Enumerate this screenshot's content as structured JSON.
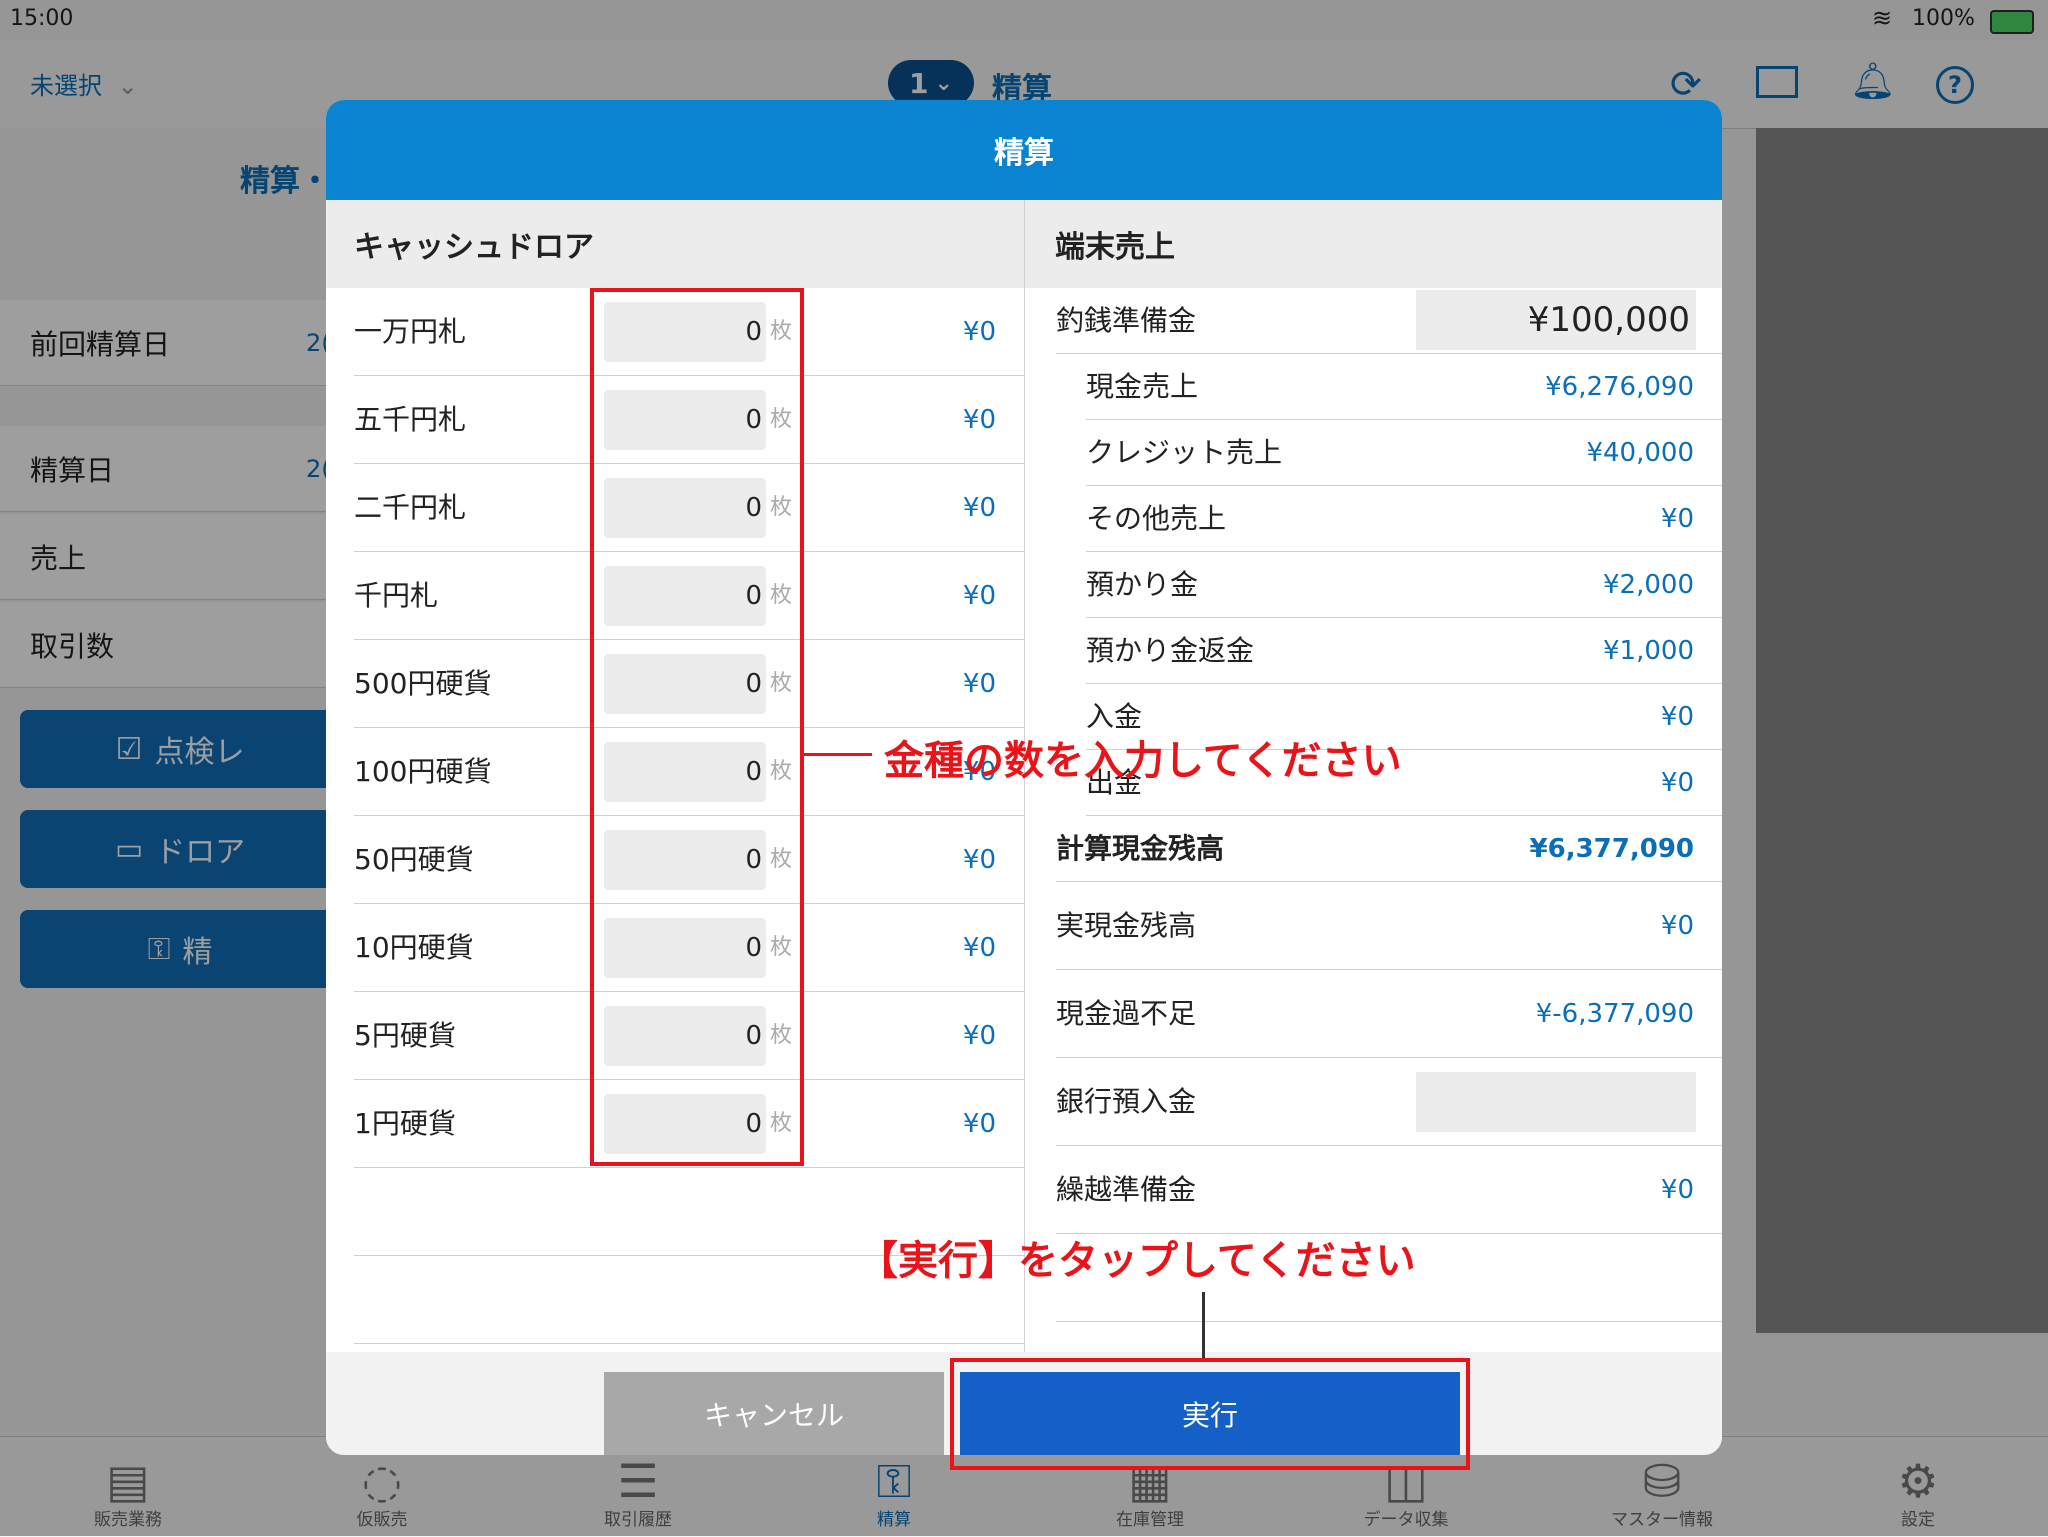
{
  "status_bar": {
    "time": "15:00",
    "battery": "100%"
  },
  "header": {
    "store_selector": "未選択",
    "register_number": "1",
    "title": "精算"
  },
  "background": {
    "section_title": "精算・",
    "rows": [
      {
        "label": "前回精算日",
        "value": "2("
      },
      {
        "label": "精算日",
        "value": "2("
      },
      {
        "label": "売上",
        "value": ""
      },
      {
        "label": "取引数",
        "value": ""
      }
    ],
    "buttons": [
      "点検レ",
      "ドロア",
      "精"
    ]
  },
  "modal": {
    "title": "精算",
    "left": {
      "header": "キャッシュドロア",
      "unit": "枚",
      "rows": [
        {
          "label": "一万円札",
          "count": "0",
          "amount": "¥0"
        },
        {
          "label": "五千円札",
          "count": "0",
          "amount": "¥0"
        },
        {
          "label": "二千円札",
          "count": "0",
          "amount": "¥0"
        },
        {
          "label": "千円札",
          "count": "0",
          "amount": "¥0"
        },
        {
          "label": "500円硬貨",
          "count": "0",
          "amount": "¥0"
        },
        {
          "label": "100円硬貨",
          "count": "0",
          "amount": "¥0"
        },
        {
          "label": "50円硬貨",
          "count": "0",
          "amount": "¥0"
        },
        {
          "label": "10円硬貨",
          "count": "0",
          "amount": "¥0"
        },
        {
          "label": "5円硬貨",
          "count": "0",
          "amount": "¥0"
        },
        {
          "label": "1円硬貨",
          "count": "0",
          "amount": "¥0"
        }
      ]
    },
    "right": {
      "header": "端末売上",
      "change_fund_label": "釣銭準備金",
      "change_fund_value": "¥100,000",
      "sub_rows": [
        {
          "label": "現金売上",
          "amount": "¥6,276,090"
        },
        {
          "label": "クレジット売上",
          "amount": "¥40,000"
        },
        {
          "label": "その他売上",
          "amount": "¥0"
        },
        {
          "label": "預かり金",
          "amount": "¥2,000"
        },
        {
          "label": "預かり金返金",
          "amount": "¥1,000"
        },
        {
          "label": "入金",
          "amount": "¥0"
        },
        {
          "label": "出金",
          "amount": "¥0"
        }
      ],
      "calc_balance_label": "計算現金残高",
      "calc_balance_value": "¥6,377,090",
      "actual_balance_label": "実現金残高",
      "actual_balance_value": "¥0",
      "diff_label": "現金過不足",
      "diff_value": "¥-6,377,090",
      "bank_label": "銀行預入金",
      "bank_value": "",
      "carry_label": "繰越準備金",
      "carry_value": "¥0"
    },
    "cancel_label": "キャンセル",
    "execute_label": "実行"
  },
  "annotations": {
    "input_hint": "金種の数を入力してください",
    "execute_hint": "【実行】をタップしてください"
  },
  "tabbar": [
    {
      "label": "販売業務",
      "icon": "register-icon"
    },
    {
      "label": "仮販売",
      "icon": "temp-sale-icon"
    },
    {
      "label": "取引履歴",
      "icon": "history-icon"
    },
    {
      "label": "精算",
      "icon": "key-icon"
    },
    {
      "label": "在庫管理",
      "icon": "inventory-icon"
    },
    {
      "label": "データ収集",
      "icon": "data-icon"
    },
    {
      "label": "マスター情報",
      "icon": "database-icon"
    },
    {
      "label": "設定",
      "icon": "gear-icon"
    }
  ]
}
